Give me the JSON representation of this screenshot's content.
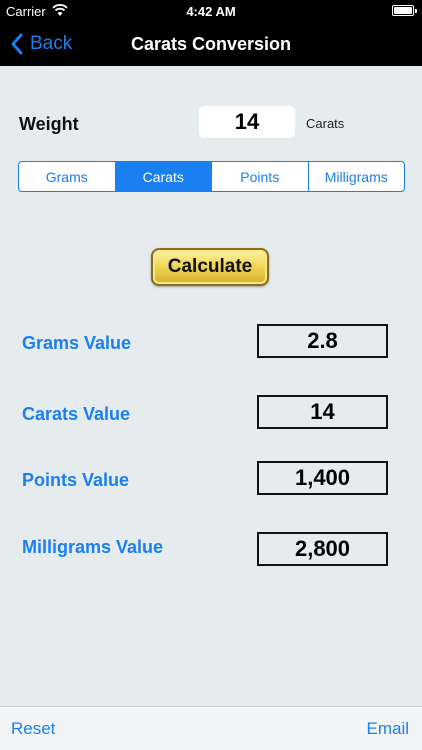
{
  "status_bar": {
    "carrier": "Carrier",
    "time": "4:42 AM"
  },
  "nav": {
    "back_label": "Back",
    "title": "Carats Conversion"
  },
  "weight": {
    "label": "Weight",
    "value": "14",
    "unit": "Carats"
  },
  "units_segmented": {
    "options": [
      "Grams",
      "Carats",
      "Points",
      "Milligrams"
    ],
    "selected": "Carats"
  },
  "calculate_label": "Calculate",
  "results": [
    {
      "label": "Grams Value",
      "value": "2.8"
    },
    {
      "label": "Carats Value",
      "value": "14"
    },
    {
      "label": "Points Value",
      "value": "1,400"
    },
    {
      "label": "Milligrams Value",
      "value": "2,800"
    }
  ],
  "toolbar": {
    "reset_label": "Reset",
    "email_label": "Email"
  },
  "colors": {
    "accent": "#1a7ff0",
    "background": "#e6ebee",
    "button_gold": "#f1d759"
  }
}
